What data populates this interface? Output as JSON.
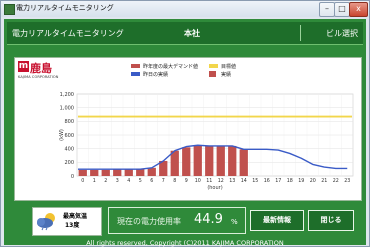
{
  "window": {
    "title": "電力リアルタイムモニタリング",
    "controls": [
      "–",
      "□",
      "x"
    ]
  },
  "header": {
    "title": "電力リアルタイムモニタリング",
    "site": "本社",
    "building_button": "ビル選択"
  },
  "logo": {
    "kanji": "鹿島",
    "mark": "m",
    "subtitle": "KAJIMA CORPORATION"
  },
  "colors": {
    "bar": "#c0504d",
    "yesterday_line": "#3a5bc7",
    "target_line": "#f2d64b",
    "accent_green": "#2f8a3a"
  },
  "chart_data": {
    "type": "bar",
    "xlabel": "(hour)",
    "ylabel": "(kW)",
    "ylim": [
      0,
      1200
    ],
    "yticks": [
      "0",
      "200",
      "400",
      "600",
      "800",
      "1,000",
      "1,200"
    ],
    "x": [
      0,
      1,
      2,
      3,
      4,
      5,
      6,
      7,
      8,
      9,
      10,
      11,
      12,
      13,
      14,
      15,
      16,
      17,
      18,
      19,
      20,
      21,
      22,
      23
    ],
    "xticks": [
      "0",
      "1",
      "2",
      "3",
      "4",
      "5",
      "6",
      "7",
      "8",
      "9",
      "10",
      "11",
      "12",
      "13",
      "14",
      "15",
      "16",
      "17",
      "18",
      "19",
      "20",
      "21",
      "22",
      "23"
    ],
    "legend": [
      {
        "name": "昨年度の最大デマンド値",
        "kind": "line",
        "color": "#c0504d"
      },
      {
        "name": "目標値",
        "kind": "line",
        "color": "#f2d64b"
      },
      {
        "name": "昨日の実績",
        "kind": "line",
        "color": "#3a5bc7"
      },
      {
        "name": "実績",
        "kind": "bar",
        "color": "#c0504d"
      }
    ],
    "series": [
      {
        "name": "実績",
        "kind": "bar",
        "values": [
          90,
          90,
          90,
          95,
          95,
          110,
          120,
          220,
          370,
          420,
          440,
          440,
          440,
          440,
          390,
          null,
          null,
          null,
          null,
          null,
          null,
          null,
          null,
          null
        ]
      },
      {
        "name": "昨日の実績",
        "kind": "line",
        "values": [
          100,
          100,
          100,
          100,
          100,
          100,
          120,
          220,
          370,
          430,
          450,
          440,
          440,
          440,
          390,
          390,
          390,
          380,
          330,
          260,
          170,
          130,
          110,
          110
        ]
      },
      {
        "name": "目標値",
        "kind": "line",
        "values": [
          870,
          870,
          870,
          870,
          870,
          870,
          870,
          870,
          870,
          870,
          870,
          870,
          870,
          870,
          870,
          870,
          870,
          870,
          870,
          870,
          870,
          870,
          870,
          870
        ]
      }
    ]
  },
  "weather": {
    "label": "最高気温",
    "value": "13度",
    "icon": "partly-cloudy-icon"
  },
  "usage": {
    "label": "現在の電力使用率",
    "value": "44.9",
    "unit": "%"
  },
  "buttons": {
    "refresh": "最新情報",
    "close": "閉じる"
  },
  "footer": {
    "copyright": "All rights reserved, Copyright (C)2011 KAJIMA CORPORATION"
  }
}
